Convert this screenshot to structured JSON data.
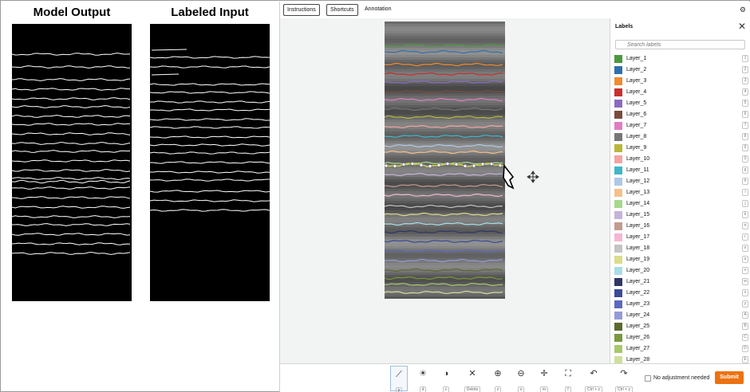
{
  "figure": {
    "left_title": "Model Output",
    "right_title": "Labeled Input"
  },
  "toolbar": {
    "instructions_label": "Instructions",
    "shortcuts_label": "Shortcuts",
    "annotation_tab": "Annotation",
    "settings_icon": "gear-icon"
  },
  "sidebar": {
    "title": "Labels",
    "search_placeholder": "Search labels",
    "labels": [
      {
        "name": "Layer_1",
        "color": "#4a9a3c",
        "key": "1"
      },
      {
        "name": "Layer_2",
        "color": "#2f6fae",
        "key": "2"
      },
      {
        "name": "Layer_3",
        "color": "#f08a2e",
        "key": "3"
      },
      {
        "name": "Layer_4",
        "color": "#c9302c",
        "key": "4"
      },
      {
        "name": "Layer_5",
        "color": "#8a6bc1",
        "key": "5"
      },
      {
        "name": "Layer_6",
        "color": "#7a4a3c",
        "key": "6"
      },
      {
        "name": "Layer_7",
        "color": "#e07cc4",
        "key": "7"
      },
      {
        "name": "Layer_8",
        "color": "#777777",
        "key": "8"
      },
      {
        "name": "Layer_9",
        "color": "#b8b83a",
        "key": "9"
      },
      {
        "name": "Layer_10",
        "color": "#f4a3a3",
        "key": "0"
      },
      {
        "name": "Layer_11",
        "color": "#3fb6c9",
        "key": "g"
      },
      {
        "name": "Layer_12",
        "color": "#aec8e8",
        "key": "h"
      },
      {
        "name": "Layer_13",
        "color": "#f6c08a",
        "key": "i"
      },
      {
        "name": "Layer_14",
        "color": "#a6d98c",
        "key": "j"
      },
      {
        "name": "Layer_15",
        "color": "#c5b3d8",
        "key": "k"
      },
      {
        "name": "Layer_16",
        "color": "#c49a8f",
        "key": "n"
      },
      {
        "name": "Layer_17",
        "color": "#f4b6d2",
        "key": "r"
      },
      {
        "name": "Layer_18",
        "color": "#c4c4c4",
        "key": "s"
      },
      {
        "name": "Layer_19",
        "color": "#dcdc8c",
        "key": "u"
      },
      {
        "name": "Layer_20",
        "color": "#a8dde6",
        "key": "v"
      },
      {
        "name": "Layer_21",
        "color": "#2e3568",
        "key": "w"
      },
      {
        "name": "Layer_22",
        "color": "#3b4a9a",
        "key": "x"
      },
      {
        "name": "Layer_23",
        "color": "#5b68c0",
        "key": "y"
      },
      {
        "name": "Layer_24",
        "color": "#949bd8",
        "key": "A"
      },
      {
        "name": "Layer_25",
        "color": "#5a6a2c",
        "key": "B"
      },
      {
        "name": "Layer_26",
        "color": "#7a9a3c",
        "key": "C"
      },
      {
        "name": "Layer_27",
        "color": "#a8c86a",
        "key": "D"
      },
      {
        "name": "Layer_28",
        "color": "#cfe09a",
        "key": "E"
      }
    ]
  },
  "bottom_toolbar": {
    "tools": [
      {
        "icon": "polyline-icon",
        "key": "p",
        "active": true
      },
      {
        "icon": "brightness-icon",
        "key": "d",
        "active": false
      },
      {
        "icon": "contrast-icon",
        "key": "c",
        "active": false
      },
      {
        "icon": "delete-icon",
        "key": "Delete",
        "active": false
      },
      {
        "icon": "zoom-in-icon",
        "key": "z",
        "active": false
      },
      {
        "icon": "zoom-out-icon",
        "key": "o",
        "active": false
      },
      {
        "icon": "move-icon",
        "key": "m",
        "active": false
      },
      {
        "icon": "fit-icon",
        "key": "f",
        "active": false
      },
      {
        "icon": "undo-icon",
        "key": "Ctrl + z",
        "active": false
      },
      {
        "icon": "redo-icon",
        "key": "Ctrl + y",
        "active": false
      }
    ],
    "no_adjustment_label": "No adjustment needed",
    "submit_label": "Submit"
  }
}
